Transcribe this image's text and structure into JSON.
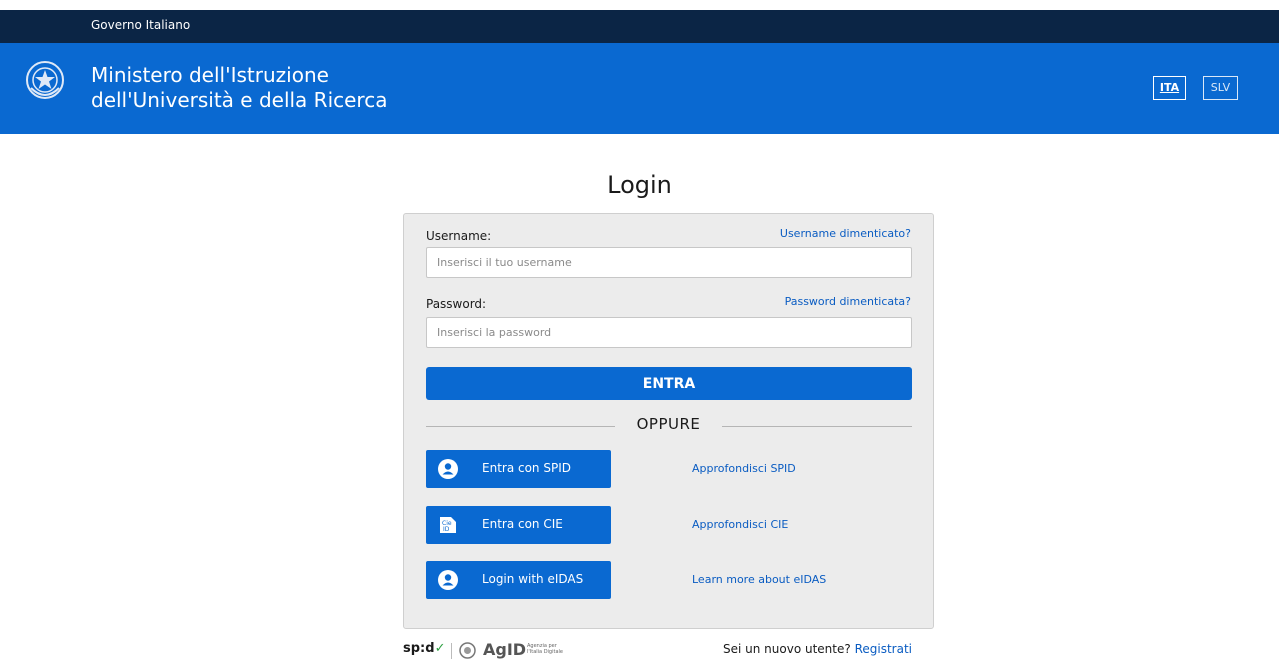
{
  "gov_bar": {
    "label": "Governo Italiano"
  },
  "header": {
    "ministry_line1": "Ministero dell'Istruzione",
    "ministry_line2": "dell'Università e della Ricerca",
    "languages": [
      {
        "code": "ITA",
        "active": true
      },
      {
        "code": "SLV",
        "active": false
      }
    ]
  },
  "login": {
    "title": "Login",
    "username_label": "Username:",
    "username_forgot": "Username dimenticato?",
    "username_placeholder": "Inserisci il tuo username",
    "password_label": "Password:",
    "password_forgot": "Password dimenticata?",
    "password_placeholder": "Inserisci la password",
    "submit_label": "ENTRA",
    "divider_label": "OPPURE"
  },
  "identity_providers": [
    {
      "icon": "user-circle-icon",
      "label": "Entra con SPID",
      "link": "Approfondisci SPID"
    },
    {
      "icon": "cie-card-icon",
      "label": "Entra con CIE",
      "link": "Approfondisci CIE"
    },
    {
      "icon": "user-circle-icon",
      "label": "Login with eIDAS",
      "link": "Learn more about eIDAS"
    }
  ],
  "footer": {
    "spid_logo": "sp:d",
    "agid_logo": "AgID",
    "agid_subtitle": "Agenzia per l'Italia Digitale",
    "register_prompt": "Sei un nuovo utente?",
    "register_link": "Registrati"
  },
  "colors": {
    "gov_bar": "#0b2545",
    "header": "#0a69d1",
    "primary": "#0a69d1",
    "link": "#0a5cc2",
    "panel": "#ececec"
  }
}
